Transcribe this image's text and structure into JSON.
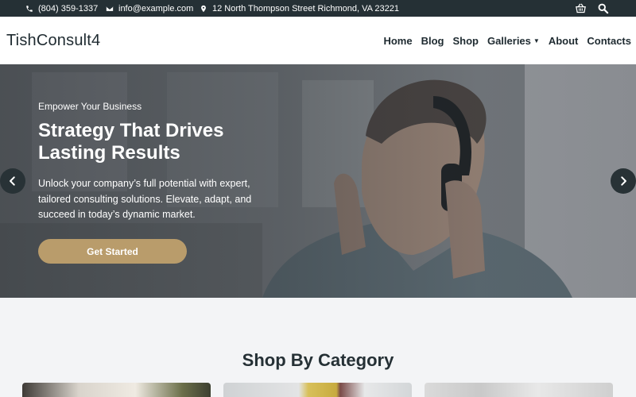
{
  "topbar": {
    "phone": "(804) 359-1337",
    "email": "info@example.com",
    "address": "12 North Thompson Street Richmond, VA 23221",
    "icons": [
      "phone-icon",
      "mail-icon",
      "location-pin-icon",
      "cart-icon",
      "search-icon"
    ]
  },
  "header": {
    "logo": "TishConsult4",
    "nav": [
      "Home",
      "Blog",
      "Shop",
      "Galleries",
      "About",
      "Contacts"
    ]
  },
  "hero": {
    "eyebrow": "Empower Your Business",
    "title": "Strategy That Drives Lasting Results",
    "text": "Unlock your company’s full potential with expert, tailored consulting solutions. Elevate, adapt, and succeed in today’s dynamic market.",
    "cta": "Get Started"
  },
  "section": {
    "title": "Shop By Category"
  },
  "colors": {
    "topbar": "#253035",
    "accent": "#b99c6b",
    "section_bg": "#f3f4f6"
  }
}
